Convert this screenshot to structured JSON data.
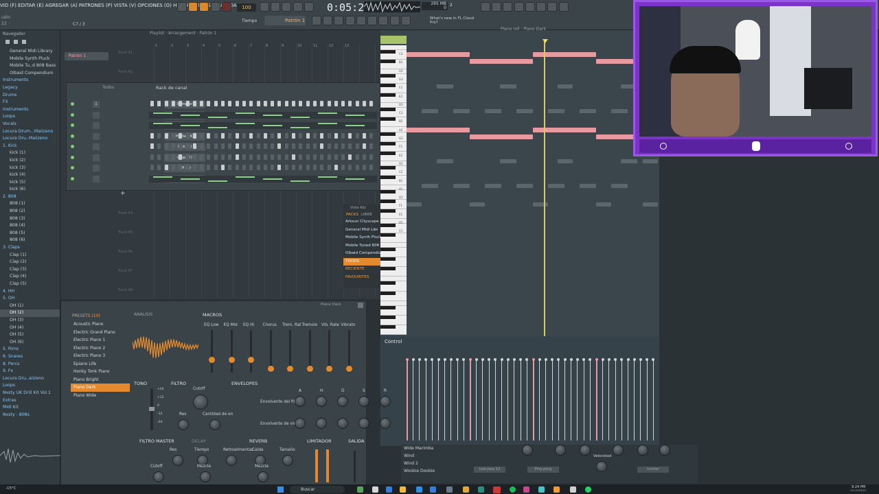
{
  "topbar": {
    "menu": "VID (F) EDITAR (E) AGREGAR (A) PATRONES (P) VISTA (V) OPCIONES (O) HERRAMIENTAS (T) AYUDA",
    "tempo": "100",
    "time": "0:05:23",
    "pattern": "Patrón 1",
    "tempo_label": "Tiempo",
    "news": "What's new in FL Cloud Pro?",
    "memory": "295 MB",
    "mem_small": "2",
    "cpu_small": "0",
    "audio_label": "udio",
    "audio_value": "22",
    "step_display": "C7 / 3"
  },
  "browser": {
    "title": "Navegador",
    "items": [
      {
        "label": "General Midi Library",
        "type": "file"
      },
      {
        "label": "Mobile Synth Pluck",
        "type": "file"
      },
      {
        "label": "Mobile Tu..d 808 Bass",
        "type": "file"
      },
      {
        "label": "Olbaid Compendium",
        "type": "file"
      },
      {
        "label": "Instruments",
        "type": "folder"
      },
      {
        "label": "Legacy",
        "type": "folder"
      },
      {
        "label": "Drums",
        "type": "folder"
      },
      {
        "label": "FX",
        "type": "folder"
      },
      {
        "label": "Instruments",
        "type": "folder"
      },
      {
        "label": "Loops",
        "type": "folder"
      },
      {
        "label": "Vocals",
        "type": "folder"
      },
      {
        "label": "Locura Drum...Maiizeno",
        "type": "folder"
      },
      {
        "label": "Locura Dru..Maiizeno",
        "type": "folder"
      },
      {
        "label": "1. Kick",
        "type": "folder"
      },
      {
        "label": "kick (1)",
        "type": "file"
      },
      {
        "label": "kick (2)",
        "type": "file"
      },
      {
        "label": "kick (3)",
        "type": "file"
      },
      {
        "label": "kick (4)",
        "type": "file"
      },
      {
        "label": "kick (5)",
        "type": "file"
      },
      {
        "label": "kick (6)",
        "type": "file"
      },
      {
        "label": "2. 808",
        "type": "folder"
      },
      {
        "label": "808 (1)",
        "type": "file"
      },
      {
        "label": "808 (2)",
        "type": "file"
      },
      {
        "label": "808 (3)",
        "type": "file"
      },
      {
        "label": "808 (4)",
        "type": "file"
      },
      {
        "label": "808 (5)",
        "type": "file"
      },
      {
        "label": "808 (6)",
        "type": "file"
      },
      {
        "label": "3. Claps",
        "type": "folder"
      },
      {
        "label": "Clap (1)",
        "type": "file"
      },
      {
        "label": "Clap (2)",
        "type": "file"
      },
      {
        "label": "Clap (3)",
        "type": "file"
      },
      {
        "label": "Clap (4)",
        "type": "file"
      },
      {
        "label": "Clap (5)",
        "type": "file"
      },
      {
        "label": "4. HH",
        "type": "folder"
      },
      {
        "label": "5. OH",
        "type": "folder"
      },
      {
        "label": "OH (1)",
        "type": "file"
      },
      {
        "label": "OH (2)",
        "type": "sel"
      },
      {
        "label": "OH (3)",
        "type": "file"
      },
      {
        "label": "OH (4)",
        "type": "file"
      },
      {
        "label": "OH (5)",
        "type": "file"
      },
      {
        "label": "OH (6)",
        "type": "file"
      },
      {
        "label": "5. Rims",
        "type": "folder"
      },
      {
        "label": "6. Snares",
        "type": "folder"
      },
      {
        "label": "8. Percs",
        "type": "folder"
      },
      {
        "label": "9. Fx",
        "type": "folder"
      },
      {
        "label": "Locura Dru..aiizeno",
        "type": "folder"
      },
      {
        "label": "Loops",
        "type": "folder"
      },
      {
        "label": "Nxsty UK Drill Kit Vol.1",
        "type": "folder"
      },
      {
        "label": "Extras",
        "type": "folder"
      },
      {
        "label": "Midi Kit",
        "type": "folder"
      },
      {
        "label": "Nxsty - 808s",
        "type": "folder"
      }
    ]
  },
  "playlist": {
    "title": "Playlist · Arrangement · Patrón 1",
    "pattern_block": "Patrón 1",
    "tracks": [
      "Track 41",
      "Track 42",
      "Track 43",
      "Track 44",
      "Track 45",
      "Track 46",
      "Track 47",
      "Track 48",
      "Track 49",
      "Track 50"
    ],
    "ruler": [
      "1",
      "2",
      "3",
      "4",
      "5",
      "6",
      "7",
      "8",
      "9",
      "10",
      "11",
      "12",
      "13"
    ]
  },
  "rack": {
    "title": "Rack de canal",
    "filter": "Todos",
    "channels": [
      {
        "num": "1",
        "name": "Sampler"
      },
      {
        "num": "",
        "name": "Electric D. Bird Guitar"
      },
      {
        "num": "",
        "name": "Violin"
      },
      {
        "num": "",
        "name": "Hi Hat (6)"
      },
      {
        "num": "",
        "name": "kick (1)"
      },
      {
        "num": "",
        "name": "Clap (2)"
      },
      {
        "num": "",
        "name": "OH (2)"
      },
      {
        "num": "",
        "name": "Piano Dark"
      }
    ],
    "add": "+"
  },
  "packs": {
    "header": "Vista Aliz",
    "tabs": [
      "PACKS",
      "LIBRE"
    ],
    "items": [
      "Arksun Cityscape",
      "General Midi Libr",
      "Mobile Synth Pluck",
      "Mobile Tuned 808 B",
      "Olbaid Compendiu"
    ],
    "cats": [
      "TODOS",
      "RECIENTE",
      "FAVOURITES"
    ]
  },
  "pianoroll": {
    "title": "Piano roll - Piano Dark",
    "key_labels": [
      "C4",
      "B3",
      "A3",
      "G3",
      "F3",
      "E3",
      "D3",
      "C3",
      "B2",
      "A2",
      "G2",
      "F2",
      "E2",
      "D2",
      "C2",
      "B1",
      "A1",
      "G1",
      "F1",
      "E1",
      "D1",
      "C1"
    ]
  },
  "control": {
    "label": "Control",
    "sub": "Velocidad"
  },
  "plugin": {
    "title": "Piano Dark",
    "presets_label": "PRESETS (10)",
    "presets": [
      "Acoustic Piano",
      "Electric Grand Piano",
      "Electric Piano 1",
      "Electric Piano 2",
      "Electric Piano 3",
      "Epiano Life",
      "Honky Tonk Piano",
      "Piano Bright",
      "Piano Dark",
      "Piano Wide"
    ],
    "selected_index": 8,
    "analysis": "ANÁLISIS",
    "macros": "MACROS",
    "macro_labels": [
      "EQ Low",
      "EQ Mid",
      "EQ Hi",
      "Chorus",
      "Trem. Rat",
      "Tremolo",
      "Vib. Rate",
      "Vibrato"
    ],
    "macro_levels": [
      0.3,
      0.3,
      0.3,
      0.1,
      0.1,
      0.1,
      0.1,
      0.1
    ],
    "tono": "TONO",
    "filtro": "FILTRO",
    "cutoff": "Cutoff",
    "res": "Res",
    "cantidad": "Cantidad de en",
    "envelopes": "ENVELOPES",
    "env_letters": [
      "A",
      "H",
      "D",
      "S",
      "R"
    ],
    "env_filter": "Envolvente del fil",
    "env_vol": "Envolvente de vo",
    "tono_scale": [
      "+24",
      "+12",
      "0",
      "-12",
      "-24"
    ],
    "filtro_master": "FILTRO MASTER",
    "delay": "DELAY",
    "reverb": "REVERB",
    "limitador": "LIMITADOR",
    "salida": "SALIDA",
    "bottom_labels": [
      "Res",
      "Tiempo",
      "Retroalimentac",
      "Caída",
      "Tamaño",
      "Cutoff",
      "Mezcla",
      "Mezcla"
    ]
  },
  "fx": {
    "list": [
      "Wide Marimba",
      "Wind",
      "Wind 2",
      "Woobie Doobie",
      "White Noise"
    ],
    "chips": [
      "Low pass 12",
      "Ping pong",
      "Limiter"
    ],
    "velocity": "Velocidad"
  },
  "taskbar": {
    "weather": "-15°C",
    "weather_sub": "Despejado",
    "search": "Buscar",
    "clock": "9:24 PM",
    "date": "1/12/2025"
  },
  "colors": {
    "accent": "#e3892e",
    "note": "#e79a9f",
    "playhead": "#d8cc59",
    "stream": "#7b34c7"
  }
}
